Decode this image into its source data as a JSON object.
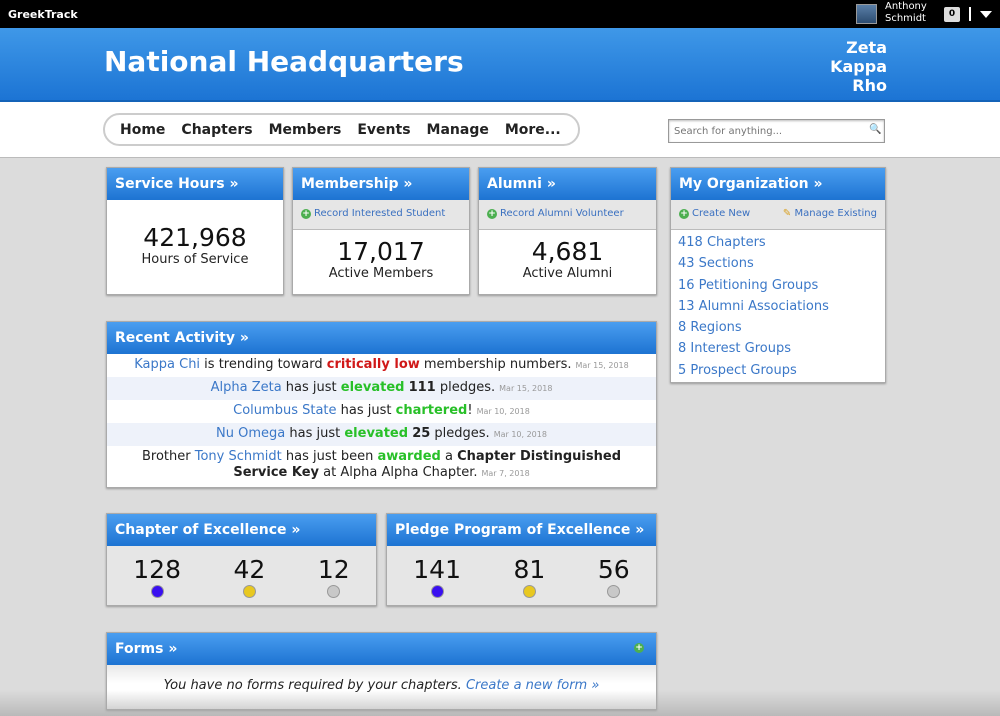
{
  "topbar": {
    "brand": "GreekTrack",
    "user_first": "Anthony",
    "user_last": "Schmidt",
    "notifications": "0"
  },
  "header": {
    "title": "National Headquarters",
    "org": [
      "Zeta",
      "Kappa",
      "Rho"
    ]
  },
  "nav": {
    "items": [
      "Home",
      "Chapters",
      "Members",
      "Events",
      "Manage",
      "More..."
    ],
    "search_placeholder": "Search for anything..."
  },
  "service": {
    "title": "Service Hours »",
    "value": "421,968",
    "label": "Hours of Service"
  },
  "membership": {
    "title": "Membership »",
    "action": "Record Interested Student",
    "value": "17,017",
    "label": "Active Members"
  },
  "alumni": {
    "title": "Alumni »",
    "action": "Record Alumni Volunteer",
    "value": "4,681",
    "label": "Active Alumni"
  },
  "org": {
    "title": "My Organization »",
    "create": "Create New",
    "manage": "Manage Existing",
    "items": [
      "418 Chapters",
      "43 Sections",
      "16 Petitioning Groups",
      "13 Alumni Associations",
      "8 Regions",
      "8 Interest Groups",
      "5 Prospect Groups"
    ]
  },
  "activity": {
    "title": "Recent Activity »",
    "rows": [
      [
        {
          "t": "Kappa Chi",
          "c": "lk"
        },
        {
          "t": " is trending toward "
        },
        {
          "t": "critically low",
          "c": "red"
        },
        {
          "t": " membership numbers."
        },
        {
          "t": "Mar 15, 2018",
          "c": "dt"
        }
      ],
      [
        {
          "t": "Alpha Zeta",
          "c": "lk"
        },
        {
          "t": " has just "
        },
        {
          "t": "elevated",
          "c": "grn"
        },
        {
          "t": " "
        },
        {
          "t": "111",
          "c": "b"
        },
        {
          "t": " pledges."
        },
        {
          "t": "Mar 15, 2018",
          "c": "dt"
        }
      ],
      [
        {
          "t": "Columbus State",
          "c": "lk"
        },
        {
          "t": " has just "
        },
        {
          "t": "chartered",
          "c": "grn"
        },
        {
          "t": "!"
        },
        {
          "t": "Mar 10, 2018",
          "c": "dt"
        }
      ],
      [
        {
          "t": "Nu Omega",
          "c": "lk"
        },
        {
          "t": " has just "
        },
        {
          "t": "elevated",
          "c": "grn"
        },
        {
          "t": " "
        },
        {
          "t": "25",
          "c": "b"
        },
        {
          "t": " pledges."
        },
        {
          "t": "Mar 10, 2018",
          "c": "dt"
        }
      ],
      [
        {
          "t": "Brother "
        },
        {
          "t": "Tony Schmidt",
          "c": "lk"
        },
        {
          "t": " has just been "
        },
        {
          "t": "awarded",
          "c": "grn"
        },
        {
          "t": " a "
        },
        {
          "t": "Chapter Distinguished Service Key",
          "c": "b"
        },
        {
          "t": " at Alpha Alpha Chapter."
        },
        {
          "t": "Mar 7, 2018",
          "c": "dt"
        }
      ]
    ]
  },
  "chapter_excellence": {
    "title": "Chapter of Excellence »",
    "values": [
      "128",
      "42",
      "12"
    ],
    "colors": [
      "#3a10f0",
      "#e8c820",
      "#c8c8c8"
    ]
  },
  "pledge_excellence": {
    "title": "Pledge Program of Excellence »",
    "values": [
      "141",
      "81",
      "56"
    ],
    "colors": [
      "#3a10f0",
      "#e8c820",
      "#c8c8c8"
    ]
  },
  "forms": {
    "title": "Forms »",
    "message": "You have no forms required by your chapters.",
    "link": "Create a new form »"
  }
}
